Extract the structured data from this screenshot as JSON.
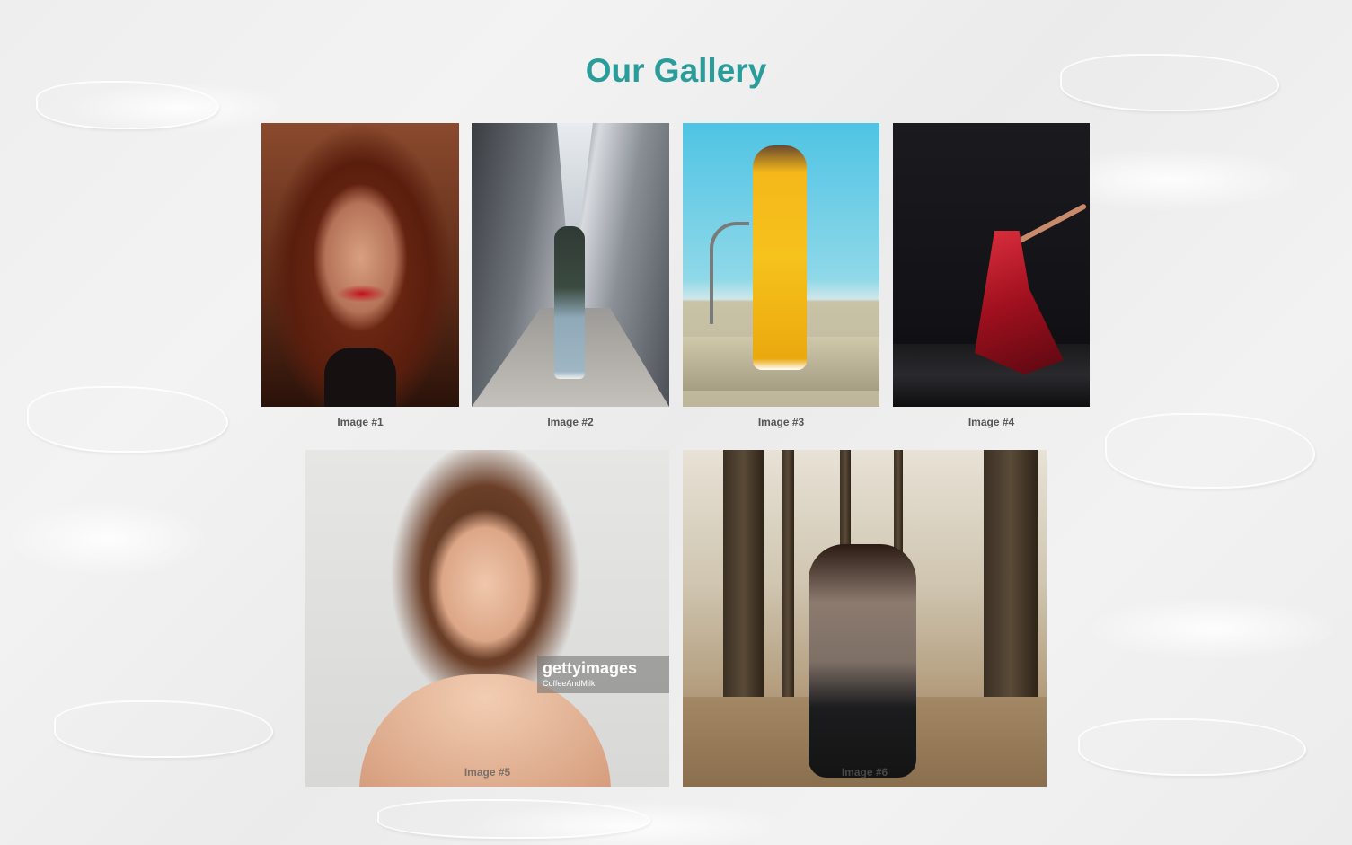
{
  "page": {
    "title": "Our Gallery",
    "accent_color": "#2a9d9a"
  },
  "gallery": {
    "row1": [
      {
        "caption": "Image #1",
        "subject": "red-hair-portrait"
      },
      {
        "caption": "Image #2",
        "subject": "man-in-metal-architecture"
      },
      {
        "caption": "Image #3",
        "subject": "woman-in-yellow-outfit"
      },
      {
        "caption": "Image #4",
        "subject": "dancer-in-red-dress"
      }
    ],
    "row2": [
      {
        "caption": "Image #5",
        "subject": "beauty-portrait",
        "watermark": "gettyimages",
        "watermark_credit": "CoffeeAndMilk"
      },
      {
        "caption": "Image #6",
        "subject": "woman-in-forest"
      }
    ]
  }
}
